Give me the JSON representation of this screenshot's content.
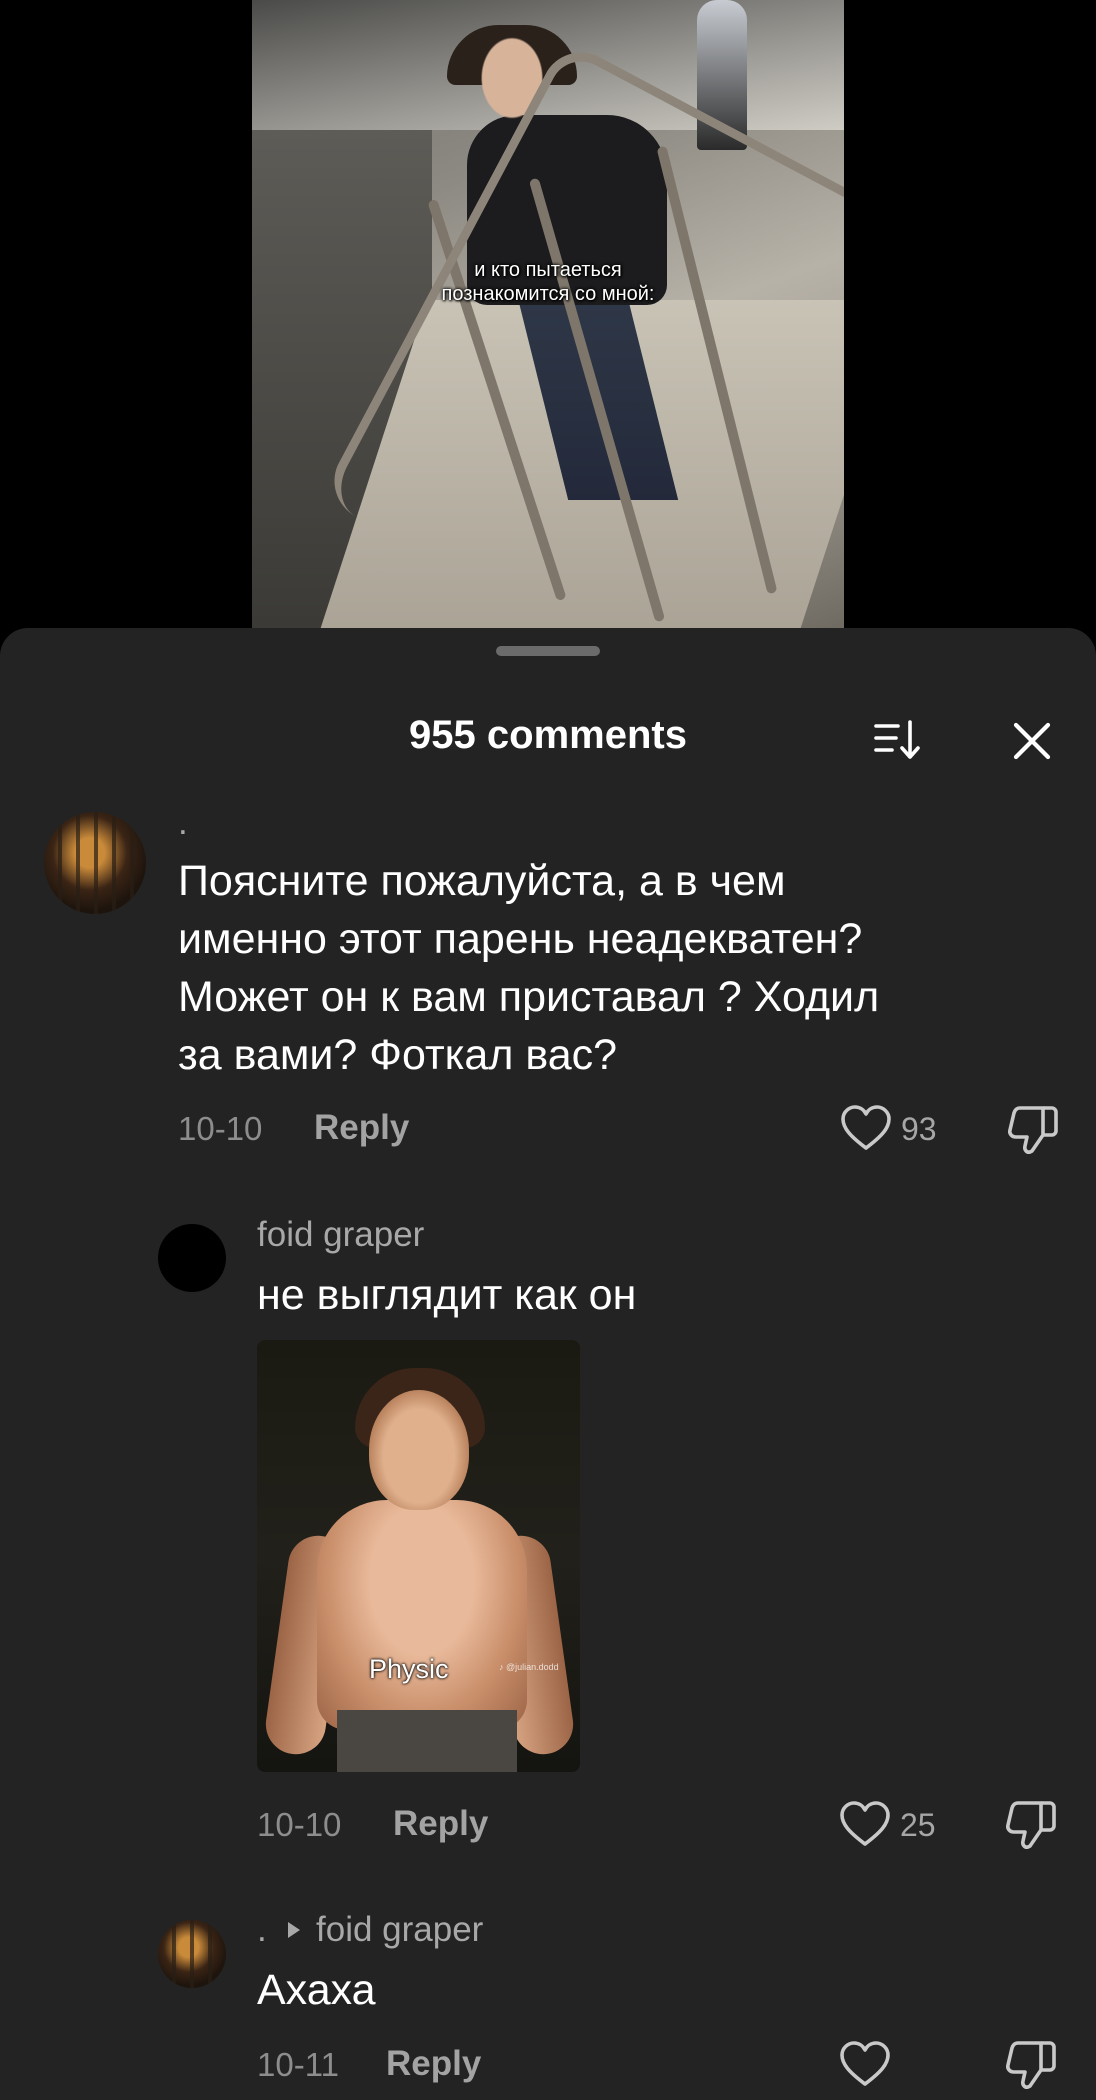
{
  "video": {
    "caption_line1": "и кто пытаеться",
    "caption_line2": "познакомится со мной:"
  },
  "comments_sheet": {
    "title": "955 comments",
    "sort_icon": "sort-icon",
    "close_icon": "close-icon"
  },
  "comments": [
    {
      "username": ".",
      "text_lines": [
        "Поясните пожалуйста, а в чем",
        "именно этот парень неадекватен?",
        "Может он к вам приставал ? Ходил",
        "за вами? Фоткал вас?"
      ],
      "date": "10-10",
      "reply_label": "Reply",
      "likes": "93"
    },
    {
      "username": "foid graper",
      "text": "не выглядит как он",
      "image_caption": "Physic",
      "image_watermark": "♪ @julian.dodd",
      "date": "10-10",
      "reply_label": "Reply",
      "likes": "25"
    },
    {
      "username": ".",
      "reply_to": "foid graper",
      "text": "Ахаха",
      "date": "10-11",
      "reply_label": "Reply",
      "likes": ""
    }
  ],
  "colors": {
    "sheet_bg": "#232323",
    "primary_text": "#ffffff",
    "secondary_text": "#a8a8a8"
  }
}
